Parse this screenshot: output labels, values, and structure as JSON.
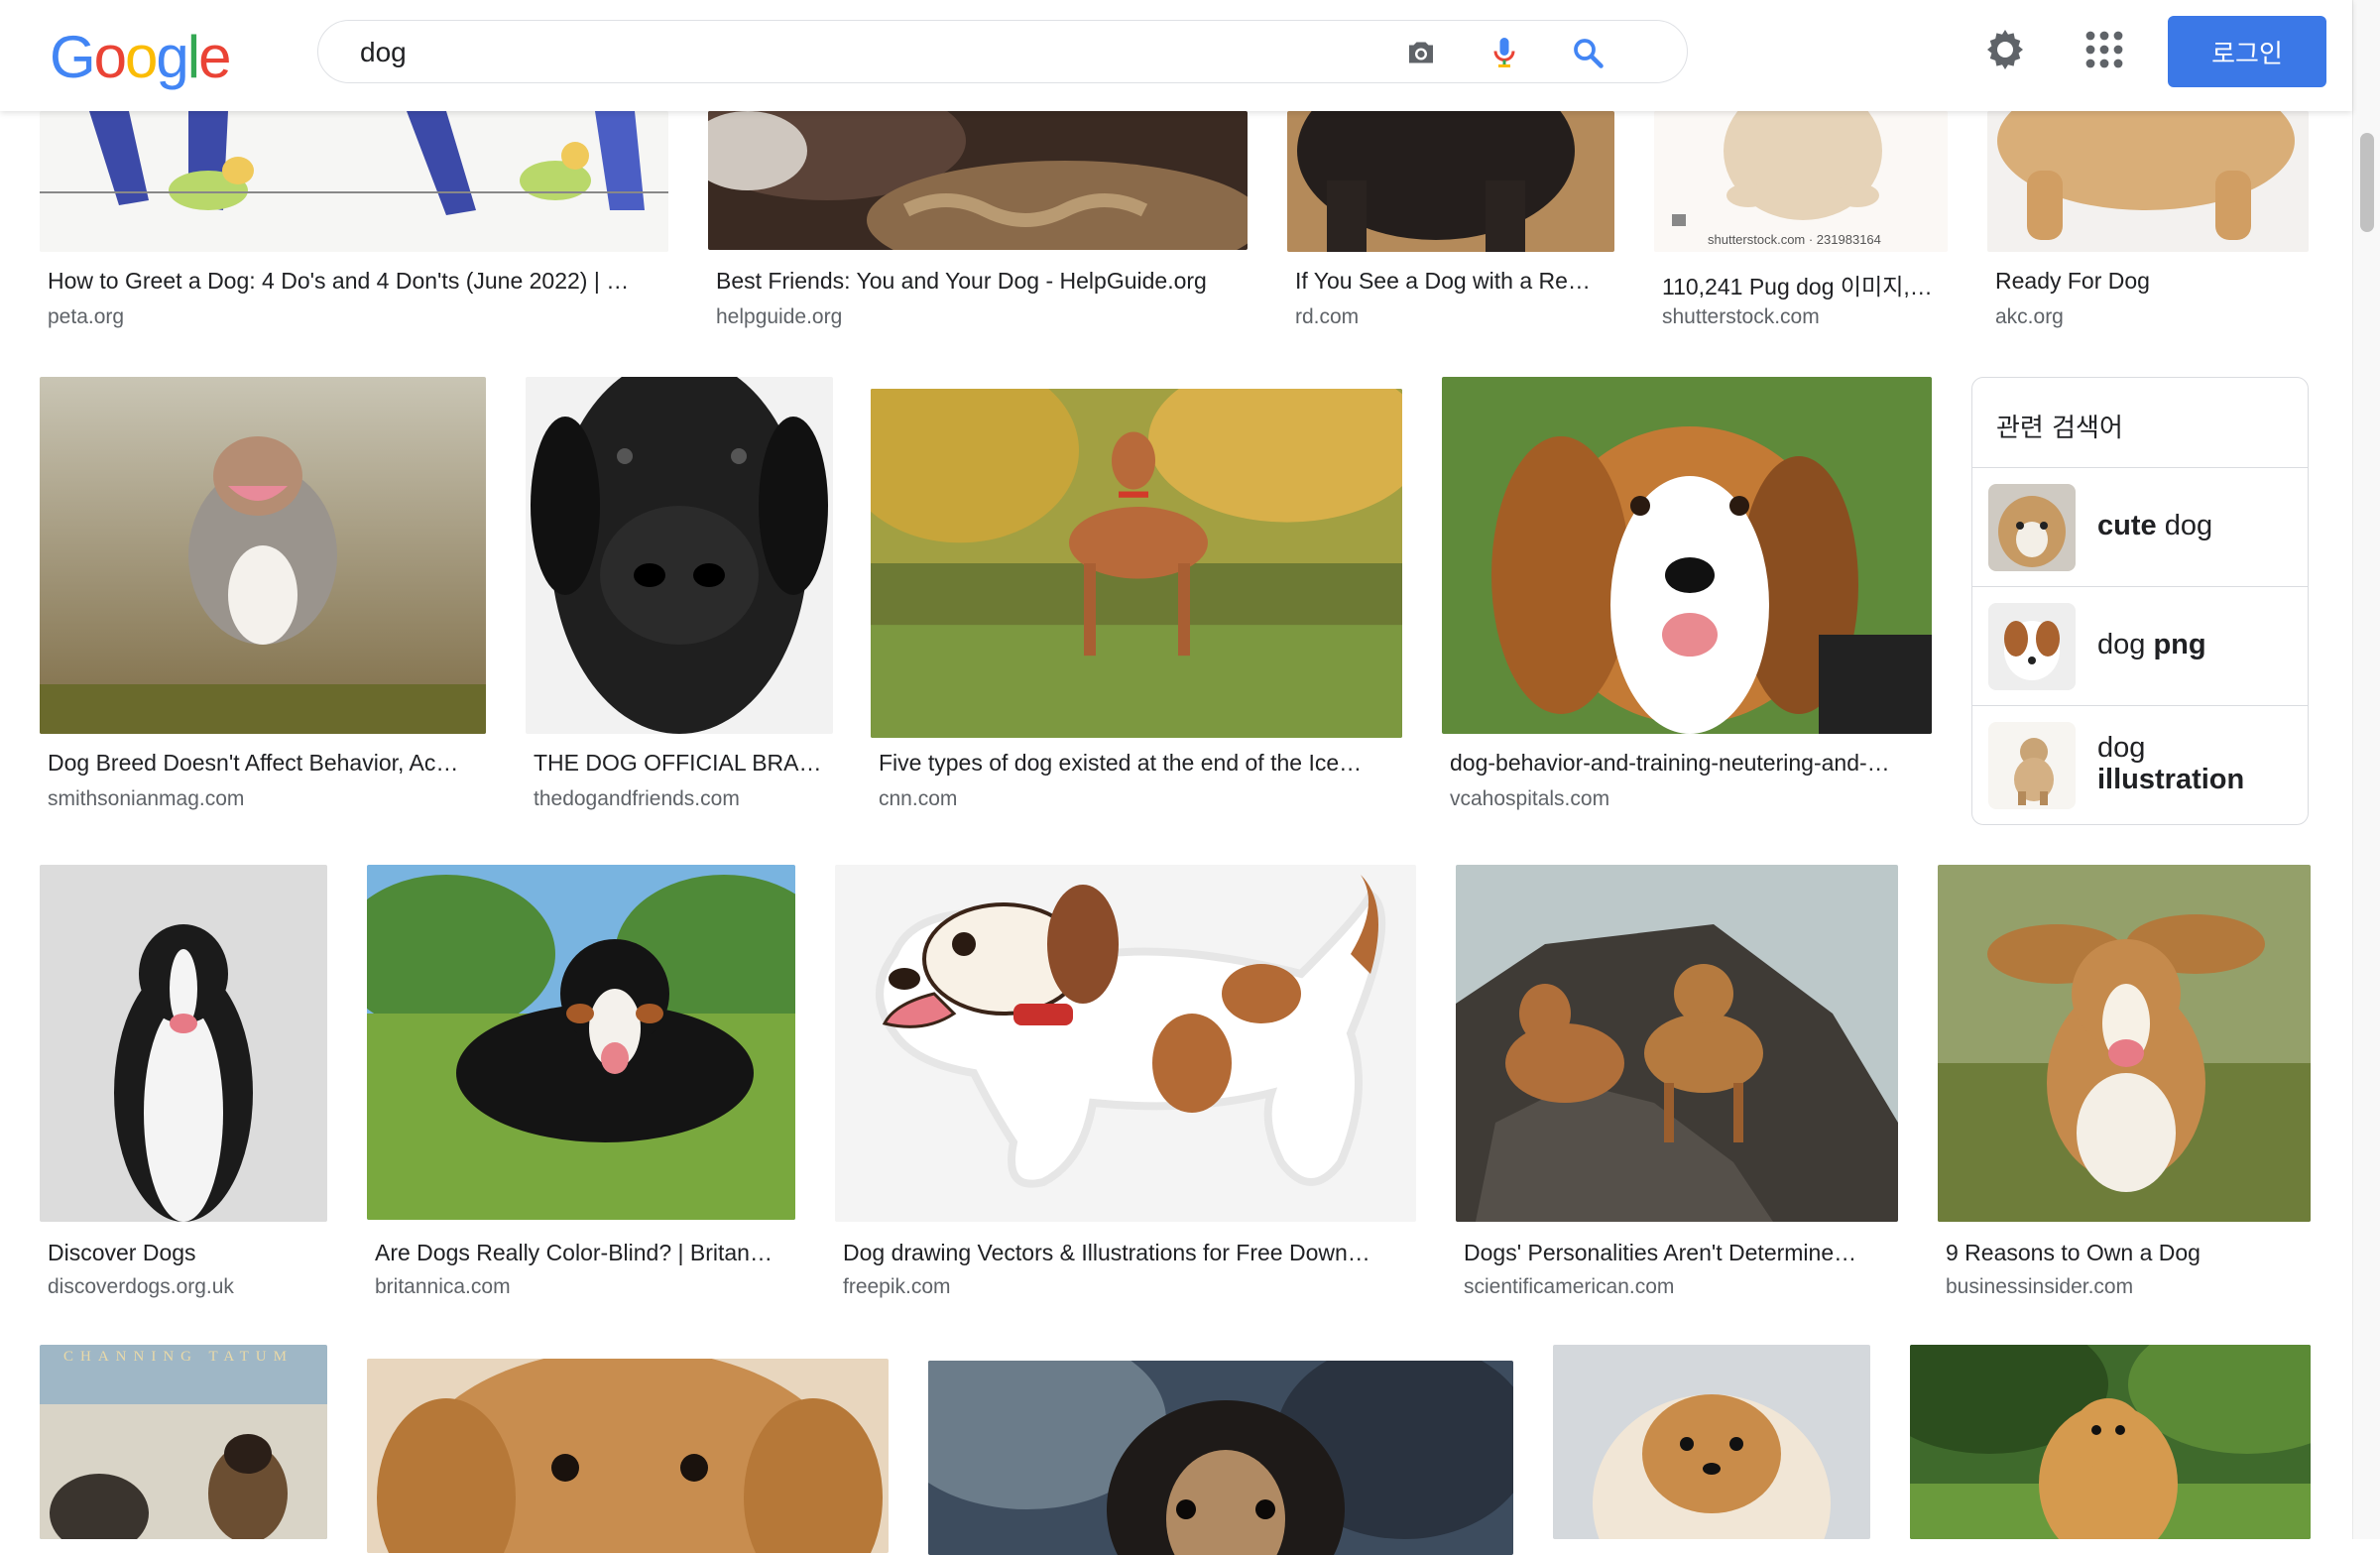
{
  "header": {
    "logo": {
      "letters": [
        "G",
        "o",
        "o",
        "g",
        "l",
        "e"
      ],
      "colors": [
        "#4285F4",
        "#EA4335",
        "#FBBC05",
        "#4285F4",
        "#34A853",
        "#EA4335"
      ]
    },
    "search_value": "dog",
    "login_label": "로그인",
    "icons": [
      "camera-icon",
      "microphone-icon",
      "search-icon",
      "gear-icon",
      "apps-grid-icon"
    ]
  },
  "results": [
    {
      "title": "How to Greet a Dog: 4 Do's and 4 Don'ts (June 2022) | …",
      "source": "peta.org"
    },
    {
      "title": "Best Friends: You and Your Dog - HelpGuide.org",
      "source": "helpguide.org"
    },
    {
      "title": "If You See a Dog with a Re…",
      "source": "rd.com"
    },
    {
      "title": "110,241 Pug dog 이미지,…",
      "source": "shutterstock.com",
      "watermark": "shutterstock.com · 231983164"
    },
    {
      "title": "Ready For Dog",
      "source": "akc.org"
    },
    {
      "title": "Dog Breed Doesn't Affect Behavior, Ac…",
      "source": "smithsonianmag.com"
    },
    {
      "title": "THE DOG OFFICIAL BRA…",
      "source": "thedogandfriends.com"
    },
    {
      "title": "Five types of dog existed at the end of the Ice…",
      "source": "cnn.com"
    },
    {
      "title": "dog-behavior-and-training-neutering-and-…",
      "source": "vcahospitals.com"
    },
    {
      "title": "Discover Dogs",
      "source": "discoverdogs.org.uk"
    },
    {
      "title": "Are Dogs Really Color-Blind? | Britan…",
      "source": "britannica.com"
    },
    {
      "title": "Dog drawing Vectors & Illustrations for Free Down…",
      "source": "freepik.com"
    },
    {
      "title": "Dogs' Personalities Aren't Determine…",
      "source": "scientificamerican.com"
    },
    {
      "title": "9 Reasons to Own a Dog",
      "source": "businessinsider.com"
    },
    {
      "title": "",
      "source": "",
      "poster_text": "CHANNING TATUM"
    },
    {
      "title": "",
      "source": ""
    },
    {
      "title": "",
      "source": ""
    },
    {
      "title": "",
      "source": ""
    },
    {
      "title": "",
      "source": ""
    }
  ],
  "related": {
    "title": "관련 검색어",
    "items": [
      {
        "bold": "cute",
        "rest": "dog"
      },
      {
        "rest": "dog",
        "bold": "png"
      },
      {
        "rest": "dog",
        "bold": "illustration"
      }
    ]
  },
  "colors": {
    "accent": "#3b78e7",
    "text": "#202124",
    "muted": "#5f6368",
    "border": "#dfe1e5"
  }
}
